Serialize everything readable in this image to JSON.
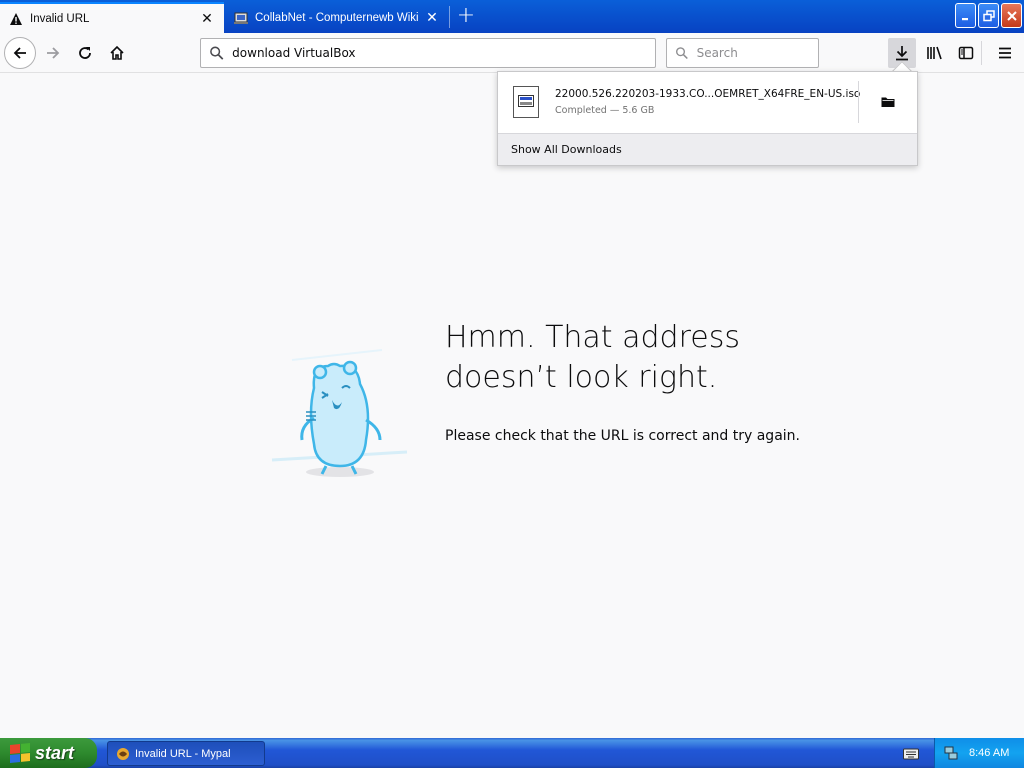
{
  "tabs": [
    {
      "title": "Invalid URL",
      "icon": "warning-icon",
      "active": true
    },
    {
      "title": "CollabNet - Computernewb Wiki",
      "icon": "wiki-favicon-icon",
      "active": false
    }
  ],
  "navbar": {
    "url_value": "download VirtualBox",
    "search_placeholder": "Search"
  },
  "downloads": {
    "items": [
      {
        "filename": "22000.526.220203-1933.CO...OEMRET_X64FRE_EN-US.iso",
        "status": "Completed — 5.6 GB"
      }
    ],
    "show_all_label": "Show All Downloads"
  },
  "error_page": {
    "title": "Hmm. That address doesn’t look right.",
    "description": "Please check that the URL is correct and try again."
  },
  "taskbar": {
    "start_label": "start",
    "task_item_label": "Invalid URL - Mypal",
    "clock": "8:46 AM"
  },
  "colors": {
    "accent": "#0a84ff",
    "tabstrip": "#0a5fd8",
    "page_background": "#f9f9fa",
    "taskbar": "#2157d7",
    "start_button": "#2e8a2e"
  }
}
